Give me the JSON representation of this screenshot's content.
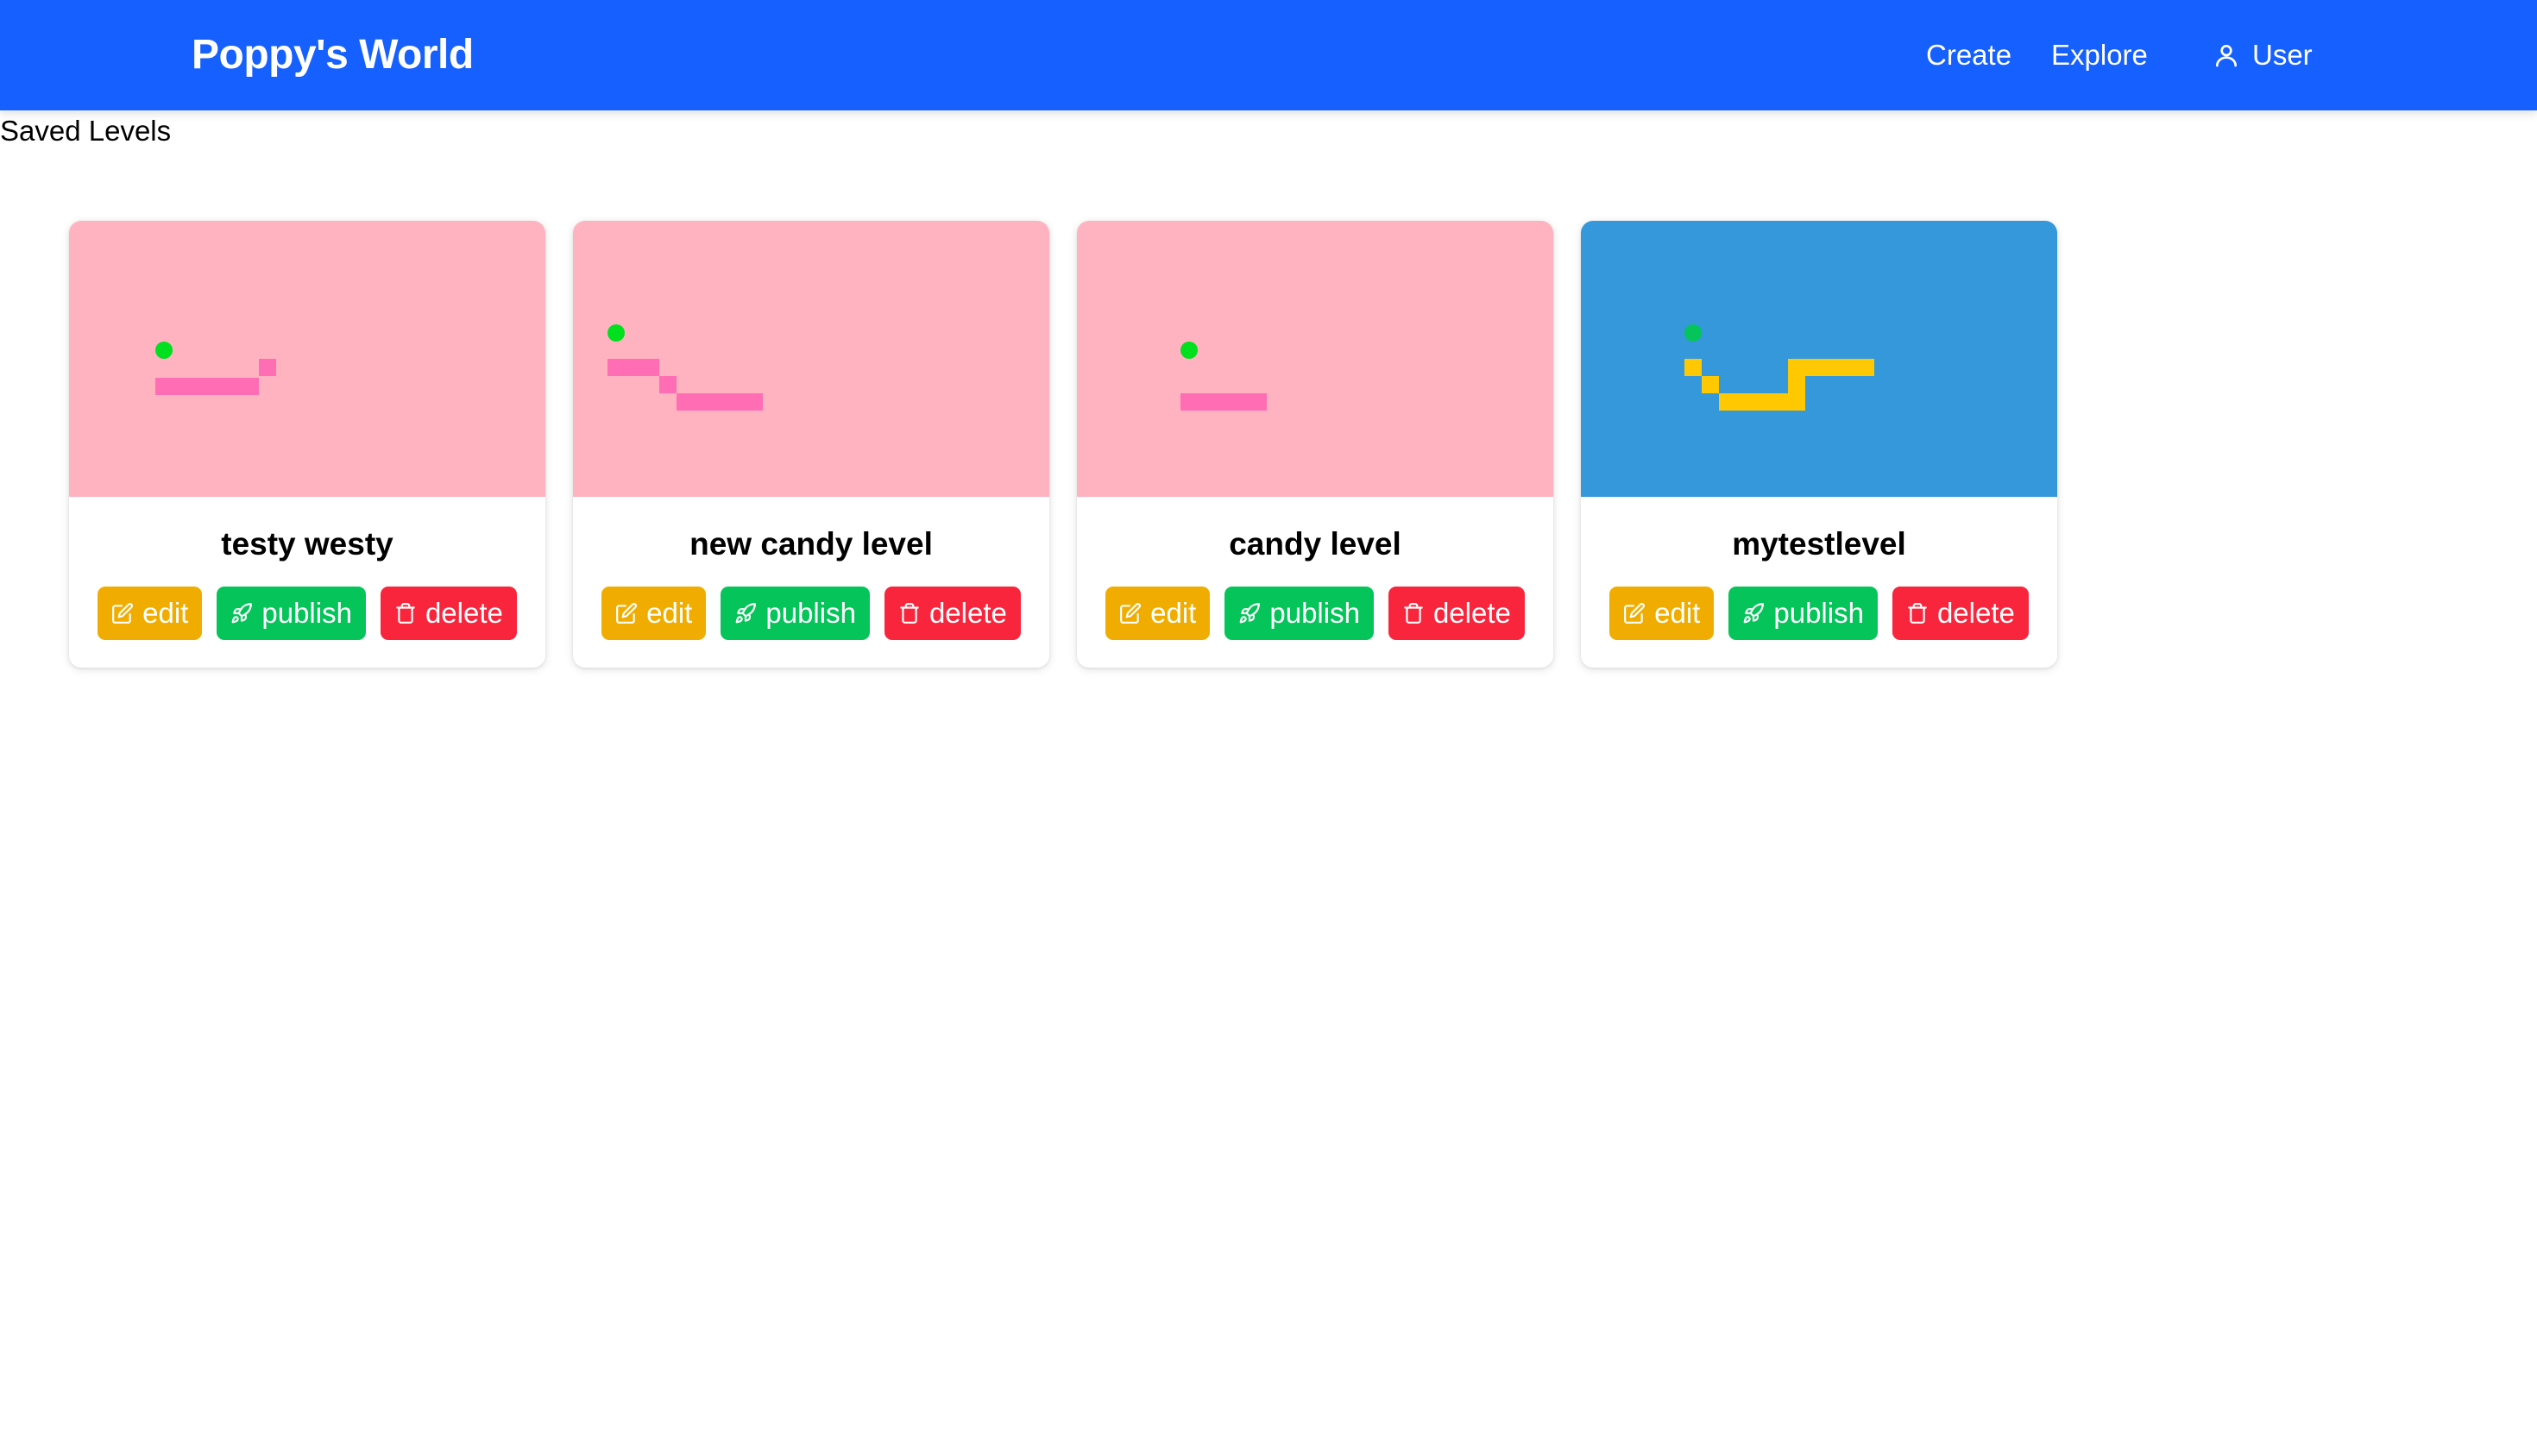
{
  "header": {
    "brand": "Poppy's World",
    "nav": {
      "create": "Create",
      "explore": "Explore",
      "user": "User"
    },
    "color": "#1660ff"
  },
  "page": {
    "heading": "Saved Levels"
  },
  "levels": [
    {
      "title": "testy westy",
      "theme": "candy",
      "preview_bg": "#ffb3c1",
      "buttons": {
        "edit": "edit",
        "publish": "publish",
        "delete": "delete"
      }
    },
    {
      "title": "new candy level",
      "theme": "candy",
      "preview_bg": "#ffb3c1",
      "buttons": {
        "edit": "edit",
        "publish": "publish",
        "delete": "delete"
      }
    },
    {
      "title": "candy level",
      "theme": "candy",
      "preview_bg": "#ffb3c1",
      "buttons": {
        "edit": "edit",
        "publish": "publish",
        "delete": "delete"
      }
    },
    {
      "title": "mytestlevel",
      "theme": "sky",
      "preview_bg": "#3498db",
      "buttons": {
        "edit": "edit",
        "publish": "publish",
        "delete": "delete"
      }
    }
  ],
  "colors": {
    "edit": "#f0ad00",
    "publish": "#05c45a",
    "delete": "#f8253c",
    "candy_platform": "#ff6eb4",
    "sky_platform": "#ffc800",
    "player_dot": "#00e01e"
  },
  "icons": {
    "edit": "edit-icon",
    "publish": "rocket-icon",
    "delete": "trash-icon",
    "user": "user-icon"
  }
}
